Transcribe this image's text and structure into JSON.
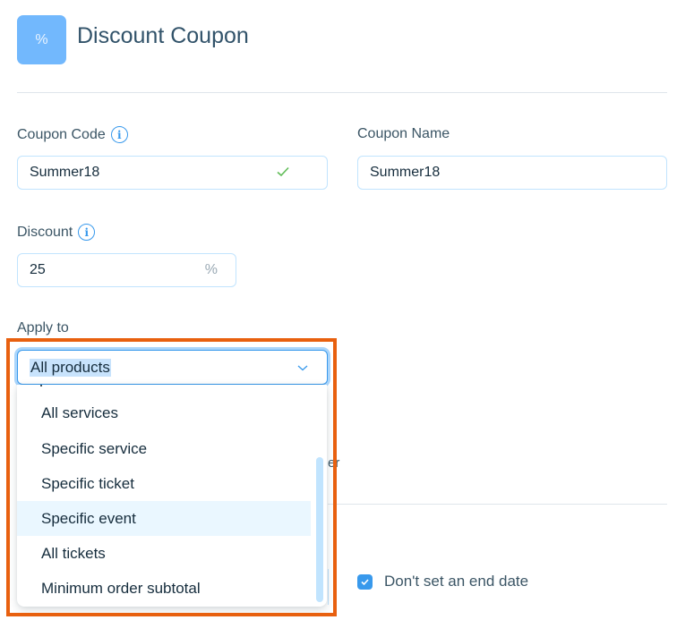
{
  "header": {
    "icon_glyph": "%",
    "title": "Discount Coupon"
  },
  "form": {
    "coupon_code": {
      "label": "Coupon Code",
      "value": "Summer18",
      "valid": true
    },
    "coupon_name": {
      "label": "Coupon Name",
      "value": "Summer18"
    },
    "discount": {
      "label": "Discount",
      "value": "25",
      "suffix": "%"
    },
    "apply_to": {
      "label": "Apply to",
      "selected": "All products",
      "options": [
        "All services",
        "Specific service",
        "Specific ticket",
        "Specific event",
        "All tickets",
        "Minimum order subtotal"
      ],
      "hovered_option": "Specific event"
    },
    "behind_dropdown_text": "er",
    "end_date": {
      "checkbox_label": "Don't set an end date",
      "checked": true
    }
  },
  "colors": {
    "accent": "#3899ec",
    "icon_bg": "#72b8fd",
    "highlight_border": "#e8600f",
    "valid_check": "#60bc57"
  }
}
